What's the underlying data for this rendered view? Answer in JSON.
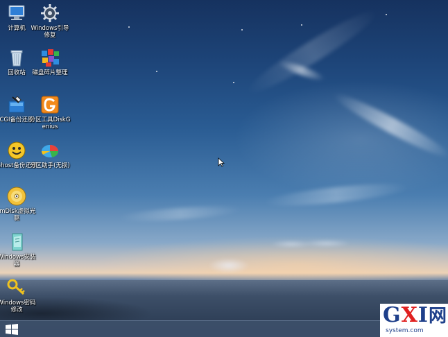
{
  "desktop": {
    "icons": [
      {
        "label": "计算机",
        "icon": "computer-icon"
      },
      {
        "label": "Windows引导修复",
        "icon": "gear-icon"
      },
      {
        "label": "回收站",
        "icon": "recycle-bin-icon"
      },
      {
        "label": "磁盘碎片整理",
        "icon": "defrag-blocks-icon"
      },
      {
        "label": "CGI备份还原",
        "icon": "cgi-installer-icon"
      },
      {
        "label": "分区工具DiskGenius",
        "icon": "diskgenius-g-icon"
      },
      {
        "label": "Ghost备份还原",
        "icon": "ghost-smiley-icon"
      },
      {
        "label": "分区助手(无损)",
        "icon": "partition-assistant-icon"
      },
      {
        "label": "ImDisk虚拟光驱",
        "icon": "cd-disc-icon"
      },
      {
        "label": "Windows安装器",
        "icon": "windows-installer-icon"
      },
      {
        "label": "Windows密码修改",
        "icon": "key-icon"
      }
    ]
  },
  "taskbar": {
    "start_icon": "windows-logo-icon"
  },
  "watermark": {
    "brand_g": "G",
    "brand_x": "X",
    "brand_i": "I",
    "brand_wang": "网",
    "domain": "system.com",
    "brand_colors": {
      "primary": "#1e3f8a",
      "accent": "#e02020"
    }
  }
}
